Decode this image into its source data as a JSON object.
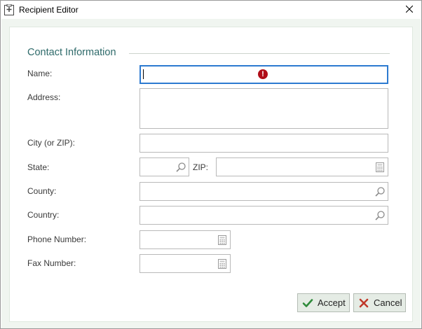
{
  "window": {
    "title": "Recipient Editor",
    "app_icon": "form-icon",
    "close_icon": "close-icon"
  },
  "group": {
    "title": "Contact Information"
  },
  "fields": {
    "name": {
      "label": "Name:",
      "value": "",
      "has_error": true
    },
    "address": {
      "label": "Address:",
      "value": ""
    },
    "city": {
      "label": "City (or ZIP):",
      "value": ""
    },
    "state": {
      "label": "State:",
      "value": ""
    },
    "zip": {
      "label": "ZIP:",
      "value": ""
    },
    "county": {
      "label": "County:",
      "value": ""
    },
    "country": {
      "label": "Country:",
      "value": ""
    },
    "phone": {
      "label": "Phone Number:",
      "value": ""
    },
    "fax": {
      "label": "Fax Number:",
      "value": ""
    }
  },
  "buttons": {
    "accept_label": "Accept",
    "cancel_label": "Cancel"
  },
  "colors": {
    "focus_border": "#2c7ad0",
    "error": "#b00d18",
    "group_title": "#2e6a6a",
    "accept_icon": "#2e8b3a",
    "cancel_icon": "#c0392b"
  }
}
